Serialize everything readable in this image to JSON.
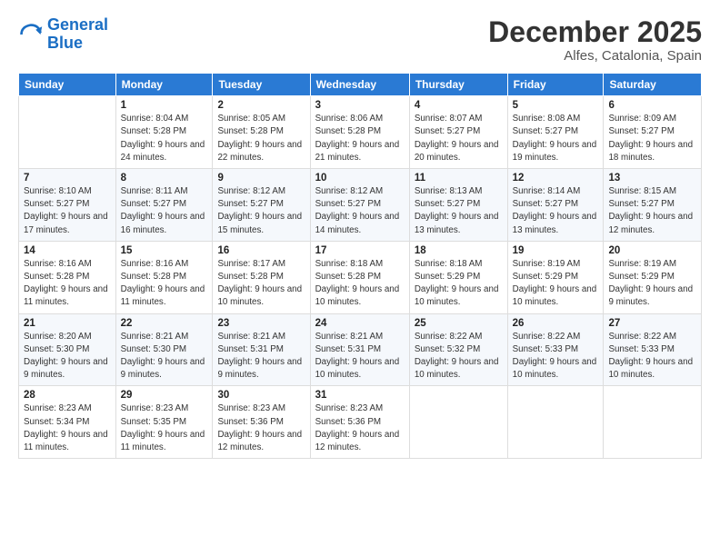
{
  "logo": {
    "line1": "General",
    "line2": "Blue"
  },
  "header": {
    "month": "December 2025",
    "location": "Alfes, Catalonia, Spain"
  },
  "weekdays": [
    "Sunday",
    "Monday",
    "Tuesday",
    "Wednesday",
    "Thursday",
    "Friday",
    "Saturday"
  ],
  "weeks": [
    [
      {
        "day": "",
        "sunrise": "",
        "sunset": "",
        "daylight": ""
      },
      {
        "day": "1",
        "sunrise": "Sunrise: 8:04 AM",
        "sunset": "Sunset: 5:28 PM",
        "daylight": "Daylight: 9 hours and 24 minutes."
      },
      {
        "day": "2",
        "sunrise": "Sunrise: 8:05 AM",
        "sunset": "Sunset: 5:28 PM",
        "daylight": "Daylight: 9 hours and 22 minutes."
      },
      {
        "day": "3",
        "sunrise": "Sunrise: 8:06 AM",
        "sunset": "Sunset: 5:28 PM",
        "daylight": "Daylight: 9 hours and 21 minutes."
      },
      {
        "day": "4",
        "sunrise": "Sunrise: 8:07 AM",
        "sunset": "Sunset: 5:27 PM",
        "daylight": "Daylight: 9 hours and 20 minutes."
      },
      {
        "day": "5",
        "sunrise": "Sunrise: 8:08 AM",
        "sunset": "Sunset: 5:27 PM",
        "daylight": "Daylight: 9 hours and 19 minutes."
      },
      {
        "day": "6",
        "sunrise": "Sunrise: 8:09 AM",
        "sunset": "Sunset: 5:27 PM",
        "daylight": "Daylight: 9 hours and 18 minutes."
      }
    ],
    [
      {
        "day": "7",
        "sunrise": "Sunrise: 8:10 AM",
        "sunset": "Sunset: 5:27 PM",
        "daylight": "Daylight: 9 hours and 17 minutes."
      },
      {
        "day": "8",
        "sunrise": "Sunrise: 8:11 AM",
        "sunset": "Sunset: 5:27 PM",
        "daylight": "Daylight: 9 hours and 16 minutes."
      },
      {
        "day": "9",
        "sunrise": "Sunrise: 8:12 AM",
        "sunset": "Sunset: 5:27 PM",
        "daylight": "Daylight: 9 hours and 15 minutes."
      },
      {
        "day": "10",
        "sunrise": "Sunrise: 8:12 AM",
        "sunset": "Sunset: 5:27 PM",
        "daylight": "Daylight: 9 hours and 14 minutes."
      },
      {
        "day": "11",
        "sunrise": "Sunrise: 8:13 AM",
        "sunset": "Sunset: 5:27 PM",
        "daylight": "Daylight: 9 hours and 13 minutes."
      },
      {
        "day": "12",
        "sunrise": "Sunrise: 8:14 AM",
        "sunset": "Sunset: 5:27 PM",
        "daylight": "Daylight: 9 hours and 13 minutes."
      },
      {
        "day": "13",
        "sunrise": "Sunrise: 8:15 AM",
        "sunset": "Sunset: 5:27 PM",
        "daylight": "Daylight: 9 hours and 12 minutes."
      }
    ],
    [
      {
        "day": "14",
        "sunrise": "Sunrise: 8:16 AM",
        "sunset": "Sunset: 5:28 PM",
        "daylight": "Daylight: 9 hours and 11 minutes."
      },
      {
        "day": "15",
        "sunrise": "Sunrise: 8:16 AM",
        "sunset": "Sunset: 5:28 PM",
        "daylight": "Daylight: 9 hours and 11 minutes."
      },
      {
        "day": "16",
        "sunrise": "Sunrise: 8:17 AM",
        "sunset": "Sunset: 5:28 PM",
        "daylight": "Daylight: 9 hours and 10 minutes."
      },
      {
        "day": "17",
        "sunrise": "Sunrise: 8:18 AM",
        "sunset": "Sunset: 5:28 PM",
        "daylight": "Daylight: 9 hours and 10 minutes."
      },
      {
        "day": "18",
        "sunrise": "Sunrise: 8:18 AM",
        "sunset": "Sunset: 5:29 PM",
        "daylight": "Daylight: 9 hours and 10 minutes."
      },
      {
        "day": "19",
        "sunrise": "Sunrise: 8:19 AM",
        "sunset": "Sunset: 5:29 PM",
        "daylight": "Daylight: 9 hours and 10 minutes."
      },
      {
        "day": "20",
        "sunrise": "Sunrise: 8:19 AM",
        "sunset": "Sunset: 5:29 PM",
        "daylight": "Daylight: 9 hours and 9 minutes."
      }
    ],
    [
      {
        "day": "21",
        "sunrise": "Sunrise: 8:20 AM",
        "sunset": "Sunset: 5:30 PM",
        "daylight": "Daylight: 9 hours and 9 minutes."
      },
      {
        "day": "22",
        "sunrise": "Sunrise: 8:21 AM",
        "sunset": "Sunset: 5:30 PM",
        "daylight": "Daylight: 9 hours and 9 minutes."
      },
      {
        "day": "23",
        "sunrise": "Sunrise: 8:21 AM",
        "sunset": "Sunset: 5:31 PM",
        "daylight": "Daylight: 9 hours and 9 minutes."
      },
      {
        "day": "24",
        "sunrise": "Sunrise: 8:21 AM",
        "sunset": "Sunset: 5:31 PM",
        "daylight": "Daylight: 9 hours and 10 minutes."
      },
      {
        "day": "25",
        "sunrise": "Sunrise: 8:22 AM",
        "sunset": "Sunset: 5:32 PM",
        "daylight": "Daylight: 9 hours and 10 minutes."
      },
      {
        "day": "26",
        "sunrise": "Sunrise: 8:22 AM",
        "sunset": "Sunset: 5:33 PM",
        "daylight": "Daylight: 9 hours and 10 minutes."
      },
      {
        "day": "27",
        "sunrise": "Sunrise: 8:22 AM",
        "sunset": "Sunset: 5:33 PM",
        "daylight": "Daylight: 9 hours and 10 minutes."
      }
    ],
    [
      {
        "day": "28",
        "sunrise": "Sunrise: 8:23 AM",
        "sunset": "Sunset: 5:34 PM",
        "daylight": "Daylight: 9 hours and 11 minutes."
      },
      {
        "day": "29",
        "sunrise": "Sunrise: 8:23 AM",
        "sunset": "Sunset: 5:35 PM",
        "daylight": "Daylight: 9 hours and 11 minutes."
      },
      {
        "day": "30",
        "sunrise": "Sunrise: 8:23 AM",
        "sunset": "Sunset: 5:36 PM",
        "daylight": "Daylight: 9 hours and 12 minutes."
      },
      {
        "day": "31",
        "sunrise": "Sunrise: 8:23 AM",
        "sunset": "Sunset: 5:36 PM",
        "daylight": "Daylight: 9 hours and 12 minutes."
      },
      {
        "day": "",
        "sunrise": "",
        "sunset": "",
        "daylight": ""
      },
      {
        "day": "",
        "sunrise": "",
        "sunset": "",
        "daylight": ""
      },
      {
        "day": "",
        "sunrise": "",
        "sunset": "",
        "daylight": ""
      }
    ]
  ]
}
